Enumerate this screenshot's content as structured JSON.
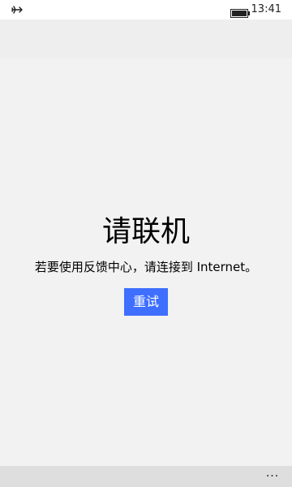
{
  "status_bar": {
    "time": "13:41",
    "airplane_mode_icon": "airplane-icon",
    "battery_icon": "battery-icon"
  },
  "main": {
    "title": "请联机",
    "message": "若要使用反馈中心，请连接到 Internet。",
    "retry_label": "重试"
  },
  "app_bar": {
    "more_label": "···"
  },
  "colors": {
    "accent": "#3f6fff",
    "background": "#f2f2f2",
    "status_bar": "#ffffff",
    "app_bar": "#dedede"
  }
}
